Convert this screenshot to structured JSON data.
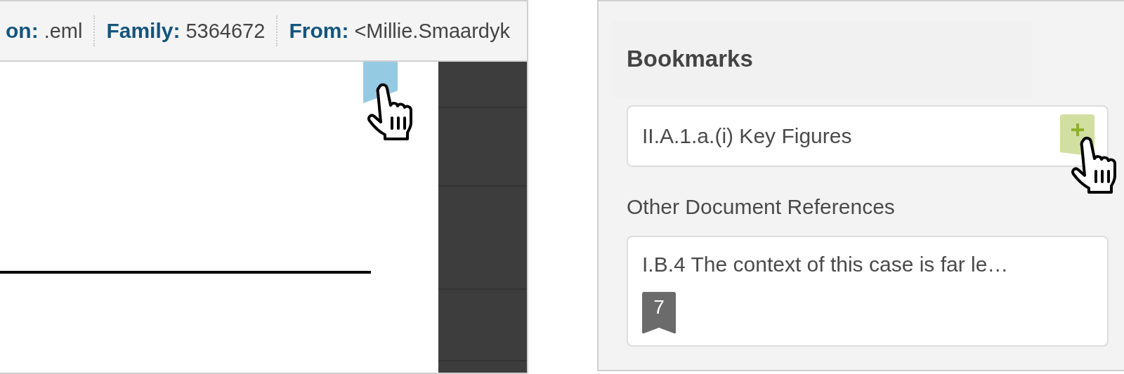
{
  "document_view": {
    "meta_fields": [
      {
        "label": "on:",
        "value": ".eml"
      },
      {
        "label": "Family:",
        "value": "5364672"
      },
      {
        "label": "From:",
        "value": "<Millie.Smaardyk"
      }
    ]
  },
  "bookmarks_panel": {
    "title": "Bookmarks",
    "current": {
      "text": "II.A.1.a.(i) Key Figures"
    },
    "section_label": "Other Document References",
    "references": [
      {
        "text": "I.B.4 The context of this case is far le…",
        "count": "7"
      }
    ]
  }
}
